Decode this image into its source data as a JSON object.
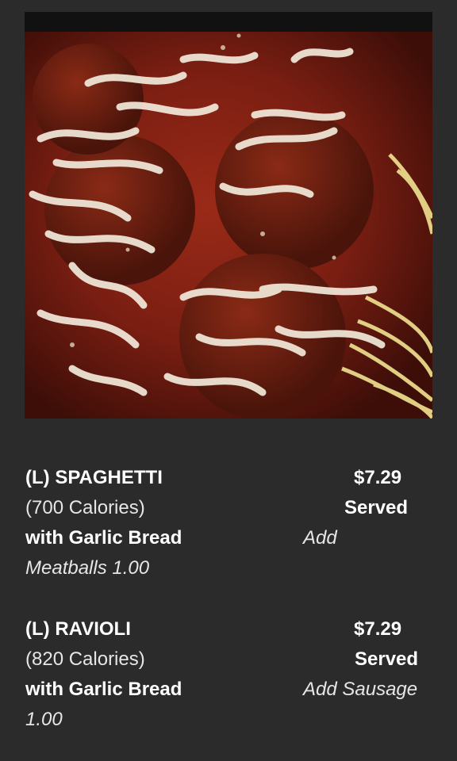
{
  "photo": {
    "subject": "spaghetti-and-meatballs-photo"
  },
  "items": [
    {
      "name": "(L) SPAGHETTI",
      "calories": "(700 Calories)",
      "with": "with Garlic Bread",
      "extra": "Meatballs 1.00",
      "price": "$7.29",
      "served": "Served",
      "add": "Add"
    },
    {
      "name": "(L) RAVIOLI",
      "calories": "(820 Calories)",
      "with": "with Garlic Bread",
      "extra": "1.00",
      "price": "$7.29",
      "served": "Served",
      "add": "Add Sausage"
    }
  ],
  "colors": {
    "background": "#2b2b2b",
    "text": "#ffffff",
    "sauce": "#7a1e12",
    "cheese": "#f2eadb",
    "pasta": "#e9d98a"
  }
}
